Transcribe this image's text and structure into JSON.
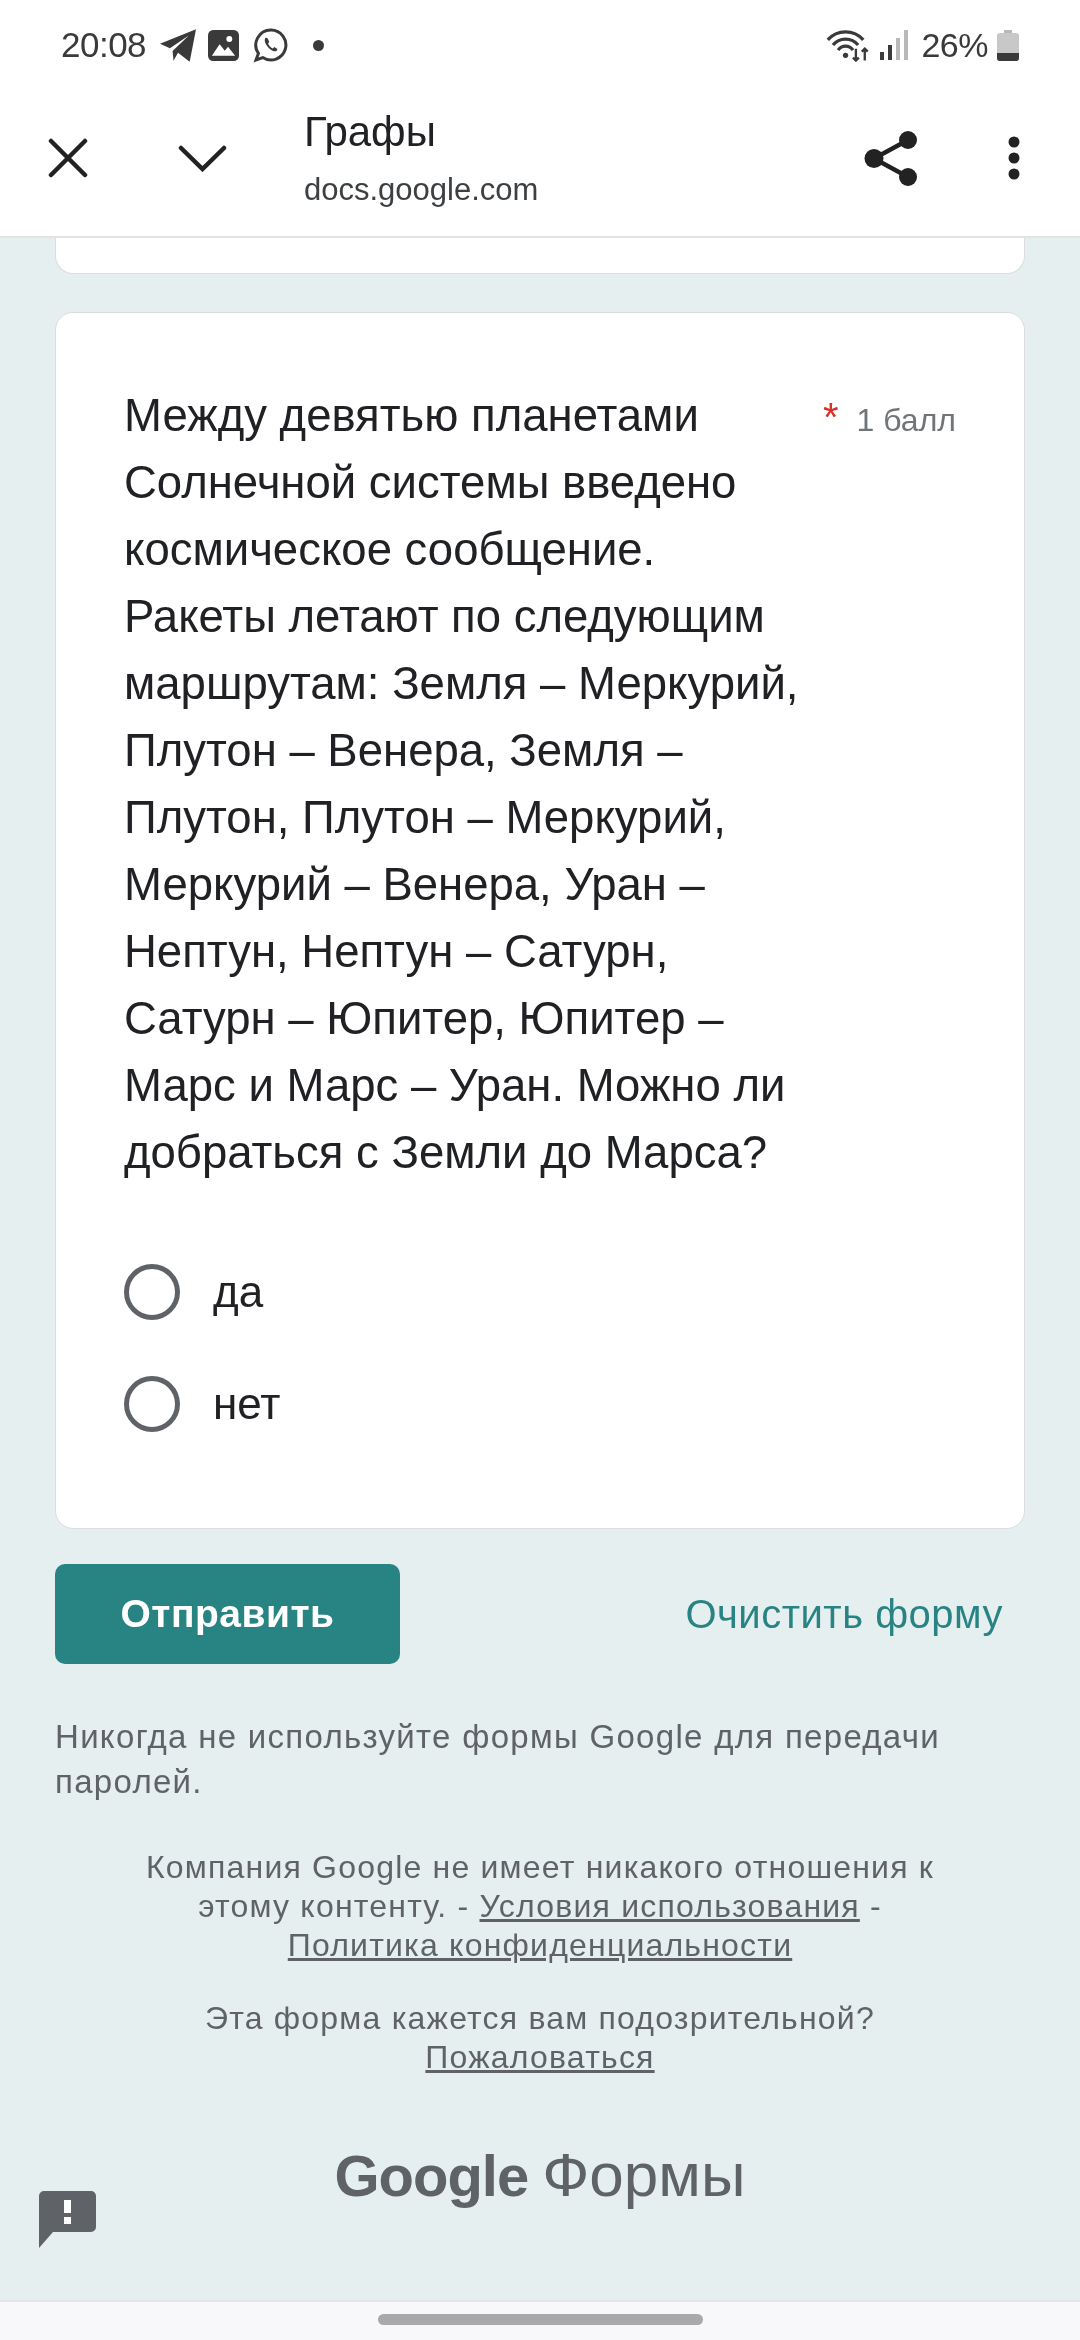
{
  "status_bar": {
    "time": "20:08",
    "battery": "26%"
  },
  "app_bar": {
    "title": "Графы",
    "url": "docs.google.com"
  },
  "question": {
    "text": "Между девятью планетами Солнечной системы введено космическое сообщение. Ракеты летают по следующим маршрутам: Земля – Меркурий, Плутон – Венера, Земля – Плутон, Плутон – Меркурий, Меркурий – Венера, Уран – Нептун, Нептун – Сатурн, Сатурн – Юпитер, Юпитер – Марс и Марс – Уран. Можно ли добраться с Земли до Марса?",
    "required_mark": "*",
    "points": "1 балл",
    "options": [
      {
        "label": "да",
        "selected": false
      },
      {
        "label": "нет",
        "selected": false
      }
    ]
  },
  "actions": {
    "submit": "Отправить",
    "clear": "Очистить форму"
  },
  "footer": {
    "warning": "Никогда не используйте формы Google для передачи паролей.",
    "disclaimer": [
      {
        "kind": "text",
        "text": "Компания Google не имеет никакого отношения к этому контенту. - "
      },
      {
        "kind": "link",
        "text": "Условия использования"
      },
      {
        "kind": "text",
        "text": " - "
      },
      {
        "kind": "link",
        "text": "Политика конфиденциальности"
      }
    ],
    "report": [
      {
        "kind": "text",
        "text": "Эта форма кажется вам подозрительной? "
      },
      {
        "kind": "link",
        "text": "Пожаловаться"
      }
    ],
    "logo": {
      "wordmark": "Google",
      "product": "Формы"
    }
  }
}
